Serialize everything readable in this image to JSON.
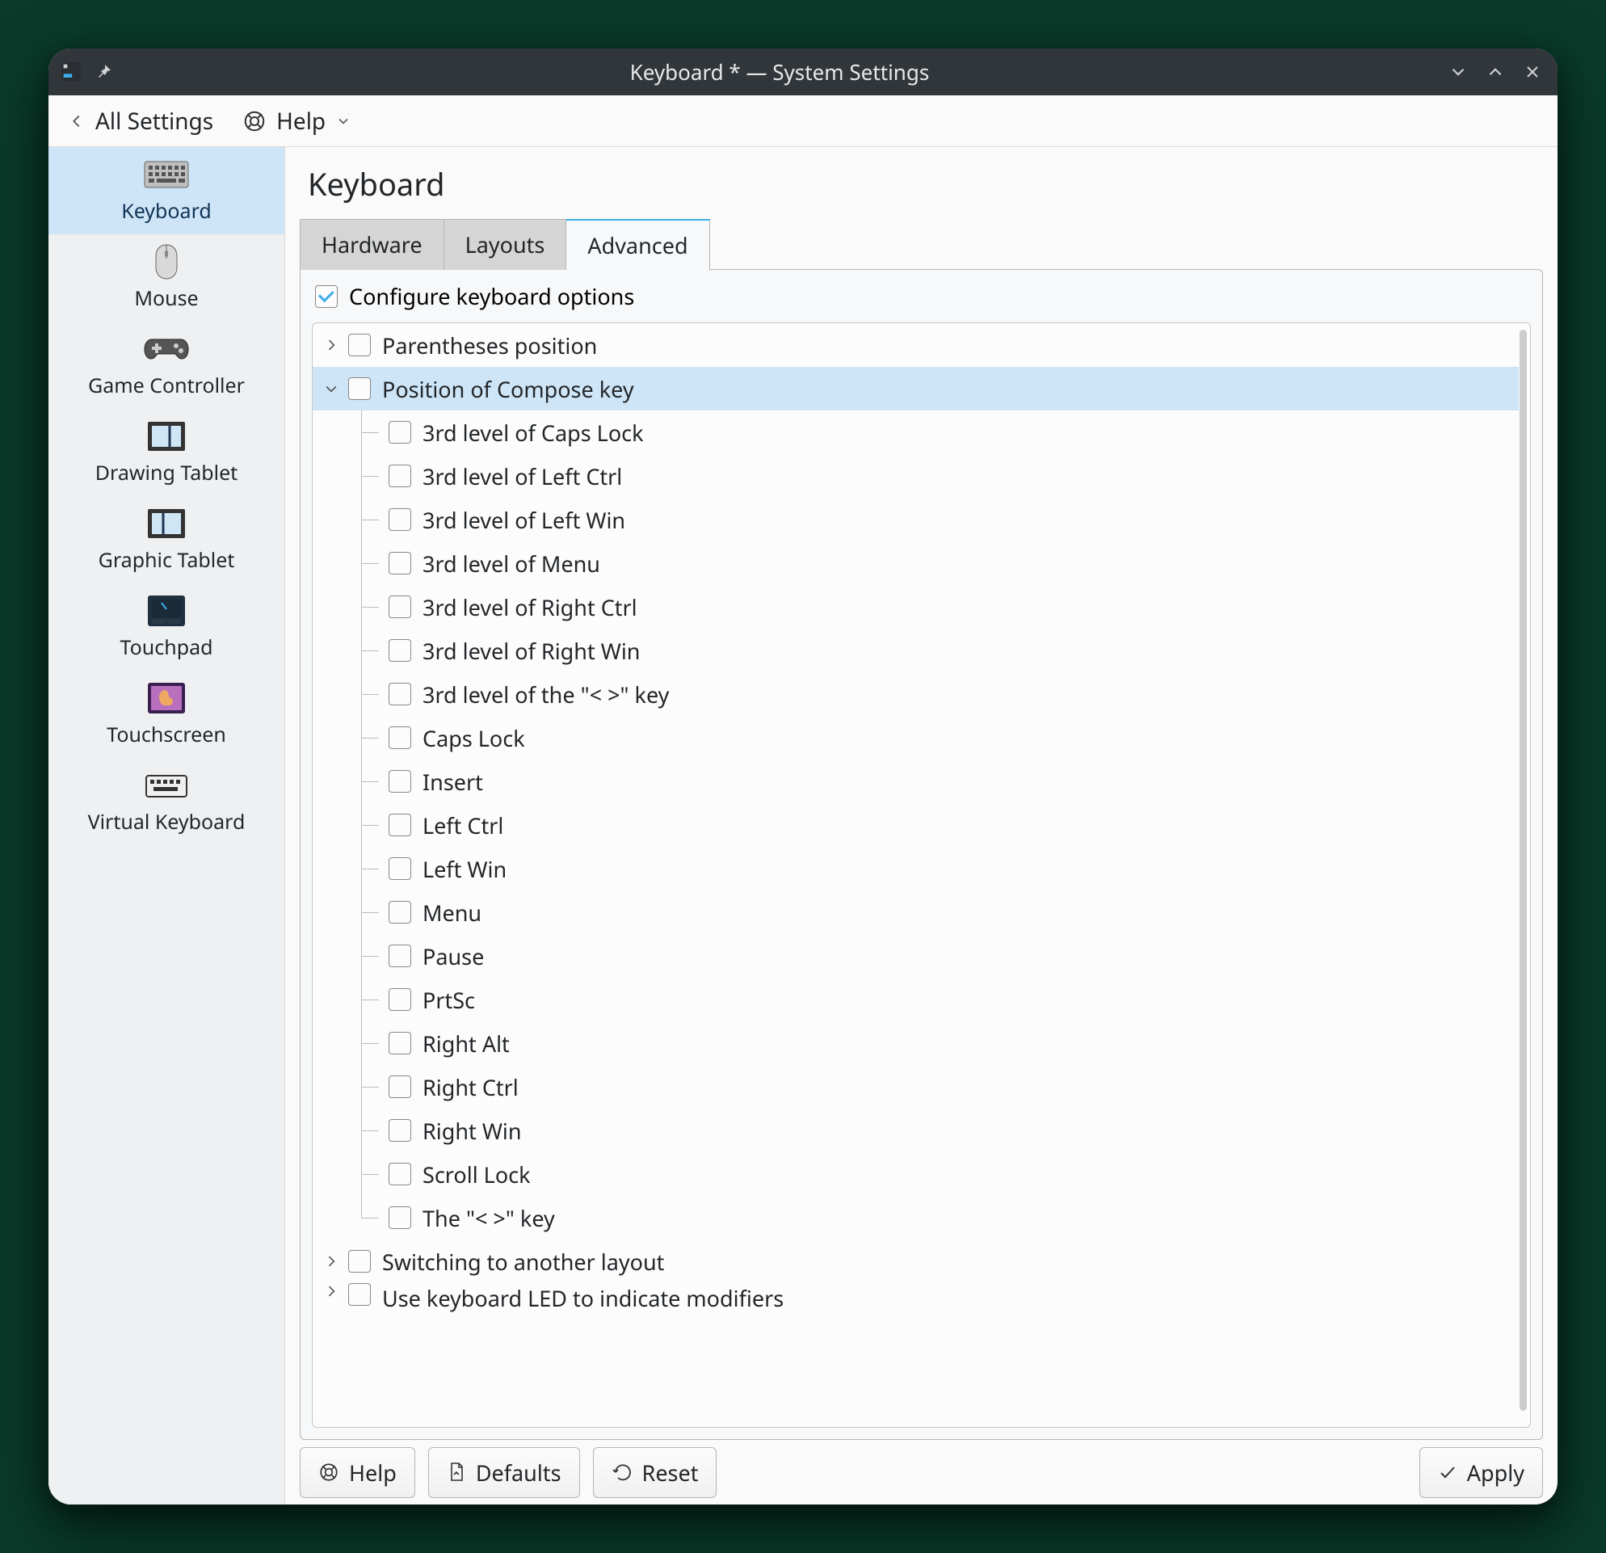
{
  "titlebar": {
    "title": "Keyboard * — System Settings"
  },
  "toolbar": {
    "back_label": "All Settings",
    "help_label": "Help"
  },
  "sidebar": {
    "items": [
      {
        "id": "keyboard",
        "label": "Keyboard",
        "selected": true
      },
      {
        "id": "mouse",
        "label": "Mouse",
        "selected": false
      },
      {
        "id": "game-controller",
        "label": "Game Controller",
        "selected": false
      },
      {
        "id": "drawing-tablet",
        "label": "Drawing Tablet",
        "selected": false
      },
      {
        "id": "graphic-tablet",
        "label": "Graphic Tablet",
        "selected": false
      },
      {
        "id": "touchpad",
        "label": "Touchpad",
        "selected": false
      },
      {
        "id": "touchscreen",
        "label": "Touchscreen",
        "selected": false
      },
      {
        "id": "virtual-keyboard",
        "label": "Virtual Keyboard",
        "selected": false
      }
    ]
  },
  "main": {
    "title": "Keyboard",
    "tabs": [
      {
        "id": "hardware",
        "label": "Hardware",
        "active": false
      },
      {
        "id": "layouts",
        "label": "Layouts",
        "active": false
      },
      {
        "id": "advanced",
        "label": "Advanced",
        "active": true
      }
    ],
    "configure_checkbox": {
      "label": "Configure keyboard options",
      "checked": true
    },
    "tree": {
      "top_nodes": [
        {
          "id": "parentheses",
          "label": "Parentheses position",
          "expanded": false
        },
        {
          "id": "compose",
          "label": "Position of Compose key",
          "expanded": true,
          "highlight": true
        }
      ],
      "compose_children": [
        "3rd level of Caps Lock",
        "3rd level of Left Ctrl",
        "3rd level of Left Win",
        "3rd level of Menu",
        "3rd level of Right Ctrl",
        "3rd level of Right Win",
        "3rd level of the \"< >\" key",
        "Caps Lock",
        "Insert",
        "Left Ctrl",
        "Left Win",
        "Menu",
        "Pause",
        "PrtSc",
        "Right Alt",
        "Right Ctrl",
        "Right Win",
        "Scroll Lock",
        "The \"< >\" key"
      ],
      "trailing_nodes": [
        {
          "id": "switching",
          "label": "Switching to another layout",
          "expanded": false
        },
        {
          "id": "led",
          "label": "Use keyboard LED to indicate modifiers",
          "expanded": false,
          "clipped": true
        }
      ]
    }
  },
  "footer": {
    "help": "Help",
    "defaults": "Defaults",
    "reset": "Reset",
    "apply": "Apply"
  }
}
